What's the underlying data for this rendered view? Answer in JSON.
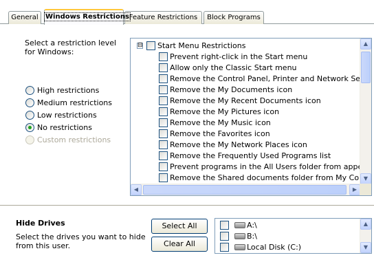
{
  "tabs": [
    {
      "label": "General",
      "active": false
    },
    {
      "label": "Windows Restrictions",
      "active": true
    },
    {
      "label": "Feature Restrictions",
      "active": false
    },
    {
      "label": "Block Programs",
      "active": false
    }
  ],
  "restriction_prompt": "Select a restriction level for Windows:",
  "restriction_levels": [
    {
      "label": "High restrictions",
      "selected": false,
      "enabled": true
    },
    {
      "label": "Medium restrictions",
      "selected": false,
      "enabled": true
    },
    {
      "label": "Low restrictions",
      "selected": false,
      "enabled": true
    },
    {
      "label": "No restrictions",
      "selected": true,
      "enabled": true
    },
    {
      "label": "Custom restrictions",
      "selected": false,
      "enabled": false
    }
  ],
  "tree": {
    "root": {
      "label": "Start Menu Restrictions",
      "expander": "⊟",
      "checked": false
    },
    "items": [
      {
        "label": "Prevent right-click in the Start menu",
        "checked": false
      },
      {
        "label": "Allow only the Classic Start menu",
        "checked": false
      },
      {
        "label": "Remove the Control Panel, Printer and Network Settings fr",
        "checked": false
      },
      {
        "label": "Remove the My Documents icon",
        "checked": false
      },
      {
        "label": "Remove the My Recent Documents icon",
        "checked": false
      },
      {
        "label": "Remove the My Pictures icon",
        "checked": false
      },
      {
        "label": "Remove the My Music icon",
        "checked": false
      },
      {
        "label": "Remove the Favorites icon",
        "checked": false
      },
      {
        "label": "Remove the My Network Places icon",
        "checked": false
      },
      {
        "label": "Remove the Frequently Used Programs list",
        "checked": false
      },
      {
        "label": "Prevent programs in the All Users folder from appearing",
        "checked": false
      },
      {
        "label": "Remove the Shared documents folder from My Computer",
        "checked": false
      }
    ],
    "scroll_up": "▲",
    "scroll_down": "▼",
    "scroll_left": "◀",
    "scroll_right": "▶"
  },
  "hide_drives": {
    "title": "Hide Drives",
    "description": "Select the drives you want to hide from this user.",
    "select_all_label": "Select All",
    "clear_all_label": "Clear All",
    "drives": [
      {
        "label": "A:\\",
        "checked": false,
        "icon": "drive-icon"
      },
      {
        "label": "B:\\",
        "checked": false,
        "icon": "drive-icon"
      },
      {
        "label": "Local Disk (C:)",
        "checked": false,
        "icon": "drive-icon"
      }
    ]
  },
  "colors": {
    "active_tab_accent": "#ffc83c",
    "radio_selected": "#21a121",
    "border": "#7f9db9",
    "disabled_text": "#aca899"
  }
}
